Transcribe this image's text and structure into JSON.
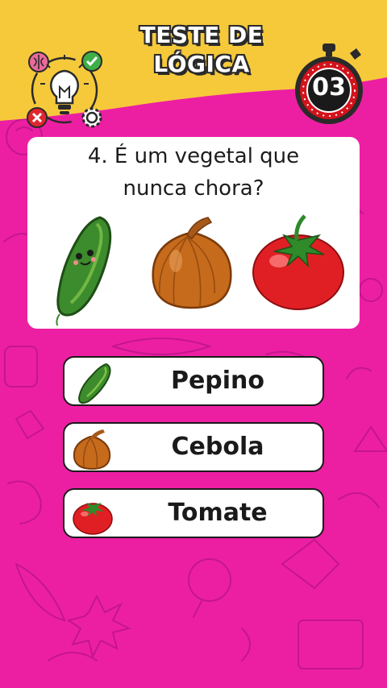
{
  "header": {
    "title_line1": "TESTE DE",
    "title_line2": "LÓGICA",
    "timer": "03",
    "colors": {
      "banner": "#f6c93b",
      "background": "#ec1fa3",
      "timer_ring": "#d3121b"
    },
    "logo_icons": [
      "brain-icon",
      "check-icon",
      "lightbulb-icon",
      "close-icon",
      "gear-icon"
    ]
  },
  "question": {
    "line1": "4. É um vegetal que",
    "line2": "nunca chora?",
    "images": [
      "cucumber-image",
      "onion-image",
      "tomato-image"
    ]
  },
  "options": [
    {
      "label": "Pepino",
      "icon": "cucumber-icon"
    },
    {
      "label": "Cebola",
      "icon": "onion-icon"
    },
    {
      "label": "Tomate",
      "icon": "tomato-icon"
    }
  ]
}
